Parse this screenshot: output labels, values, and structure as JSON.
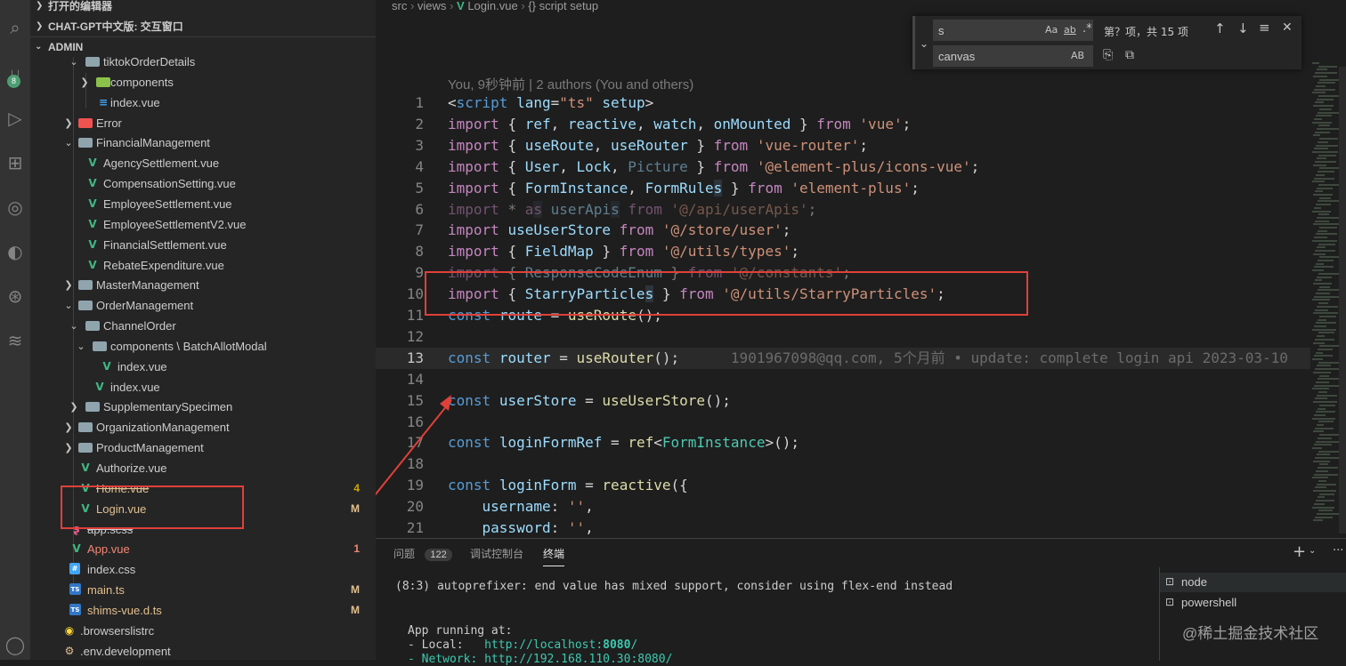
{
  "sidebar": {
    "open_editors": "打开的编辑器",
    "chat_section": "CHAT-GPT中文版: 交互窗口",
    "workspace": "ADMIN",
    "tree": [
      {
        "label": "tiktokOrderDetails"
      },
      {
        "label": "components"
      },
      {
        "label": "index.vue"
      },
      {
        "label": "Error"
      },
      {
        "label": "FinancialManagement"
      },
      {
        "label": "AgencySettlement.vue"
      },
      {
        "label": "CompensationSetting.vue"
      },
      {
        "label": "EmployeeSettlement.vue"
      },
      {
        "label": "EmployeeSettlementV2.vue"
      },
      {
        "label": "FinancialSettlement.vue"
      },
      {
        "label": "RebateExpenditure.vue"
      },
      {
        "label": "MasterManagement"
      },
      {
        "label": "OrderManagement"
      },
      {
        "label": "ChannelOrder"
      },
      {
        "label": "components \\ BatchAllotModal"
      },
      {
        "label": "index.vue"
      },
      {
        "label": "index.vue"
      },
      {
        "label": "SupplementarySpecimen"
      },
      {
        "label": "OrganizationManagement"
      },
      {
        "label": "ProductManagement"
      },
      {
        "label": "Authorize.vue"
      },
      {
        "label": "Home.vue",
        "status": "4"
      },
      {
        "label": "Login.vue",
        "status": "M"
      },
      {
        "label": "app.scss"
      },
      {
        "label": "App.vue",
        "status": "1"
      },
      {
        "label": "index.css"
      },
      {
        "label": "main.ts",
        "status": "M"
      },
      {
        "label": "shims-vue.d.ts",
        "status": "M"
      },
      {
        "label": ".browserslistrc"
      },
      {
        "label": ".env.development"
      }
    ]
  },
  "activity": {
    "scm_badge": "8"
  },
  "breadcrumb": {
    "p1": "src",
    "p2": "views",
    "p3": "Login.vue",
    "p4": "{} script setup"
  },
  "find": {
    "search_value": "s",
    "replace_value": "canvas",
    "match_case": "Aa",
    "whole_word": "ab",
    "regex": ".*",
    "result": "第？项，共 15 项",
    "preserve_case": "AB"
  },
  "editor": {
    "codelens": "You, 9秒钟前 | 2 authors (You and others)",
    "blame": "1901967098@qq.com, 5个月前 • update: complete login api 2023-03-10",
    "line_numbers": [
      "1",
      "2",
      "3",
      "4",
      "5",
      "6",
      "7",
      "8",
      "9",
      "10",
      "11",
      "12",
      "13",
      "14",
      "15",
      "16",
      "17",
      "18",
      "19",
      "20",
      "21"
    ]
  },
  "panel": {
    "tabs": {
      "problems": "问题",
      "problems_count": "122",
      "debug": "调试控制台",
      "terminal": "终端"
    },
    "terminal_lines": {
      "l1": "(8:3) autoprefixer: end value has mixed support, consider using flex-end instead",
      "l2": "App running at:",
      "l3_label": "- Local:   ",
      "l3_url": "http://localhost:",
      "l3_port": "8080",
      "l3_slash": "/",
      "l4": "- Network: http://192.168.110.30:8080/"
    },
    "terminals": [
      "node",
      "powershell"
    ],
    "watermark": "@稀土掘金技术社区"
  }
}
